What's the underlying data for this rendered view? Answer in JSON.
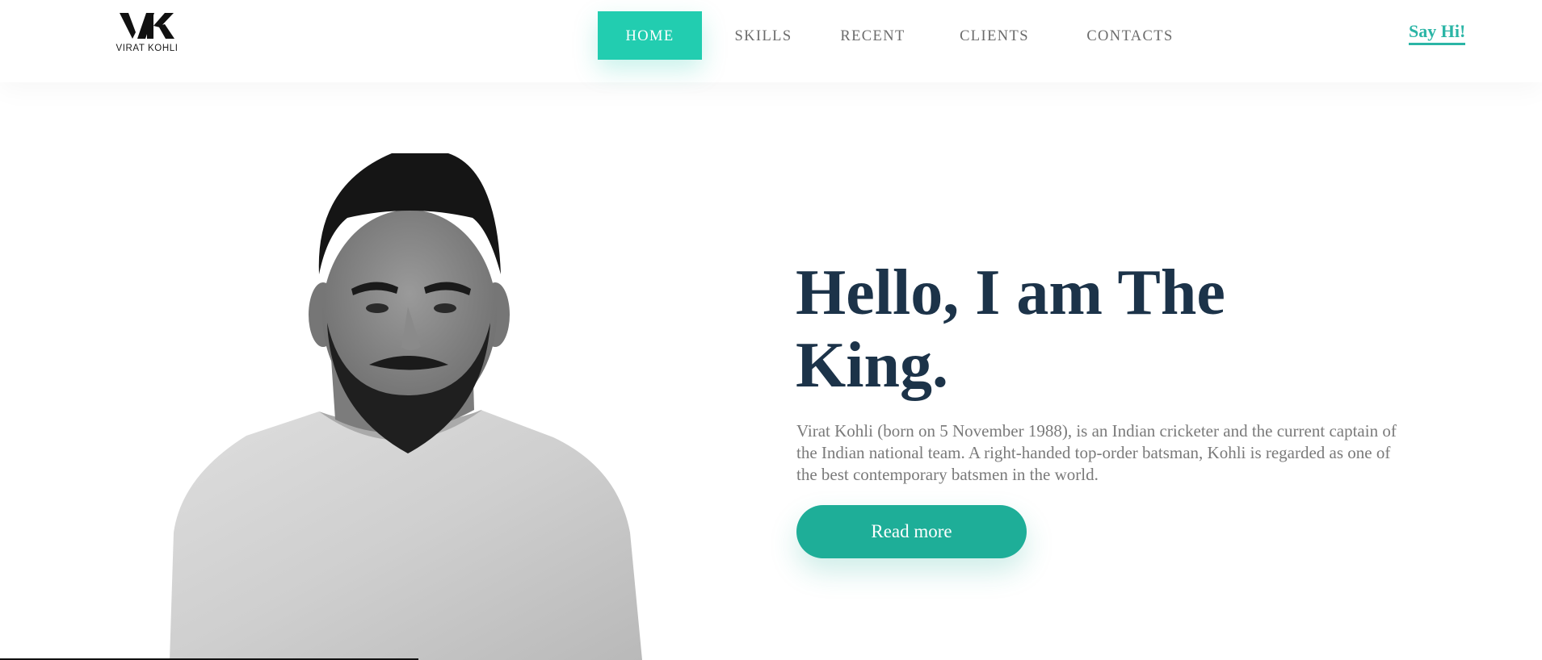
{
  "header": {
    "logo_text": "VIRAT KOHLI",
    "nav": [
      "HOME",
      "SKILLS",
      "RECENT",
      "CLIENTS",
      "CONTACTS"
    ],
    "active_nav": "HOME",
    "cta_label": "Say Hi!"
  },
  "hero": {
    "headline_line1": "Hello, I am The",
    "headline_line2": "King.",
    "description": "Virat Kohli (born on 5 November 1988), is an Indian cricketer and the current captain of the Indian national team. A right-handed top-order batsman, Kohli is regarded as one of the best contemporary batsmen in the world.",
    "button_label": "Read more"
  },
  "colors": {
    "accent": "#22cdb0",
    "button": "#1eae98",
    "link": "#2bb5a6",
    "heading": "#1c3349",
    "body_text": "#7a7a7a",
    "nav_text": "#6b6b6b"
  },
  "icons": {
    "logo": "vk-monogram-icon",
    "portrait": "person-portrait-image"
  }
}
